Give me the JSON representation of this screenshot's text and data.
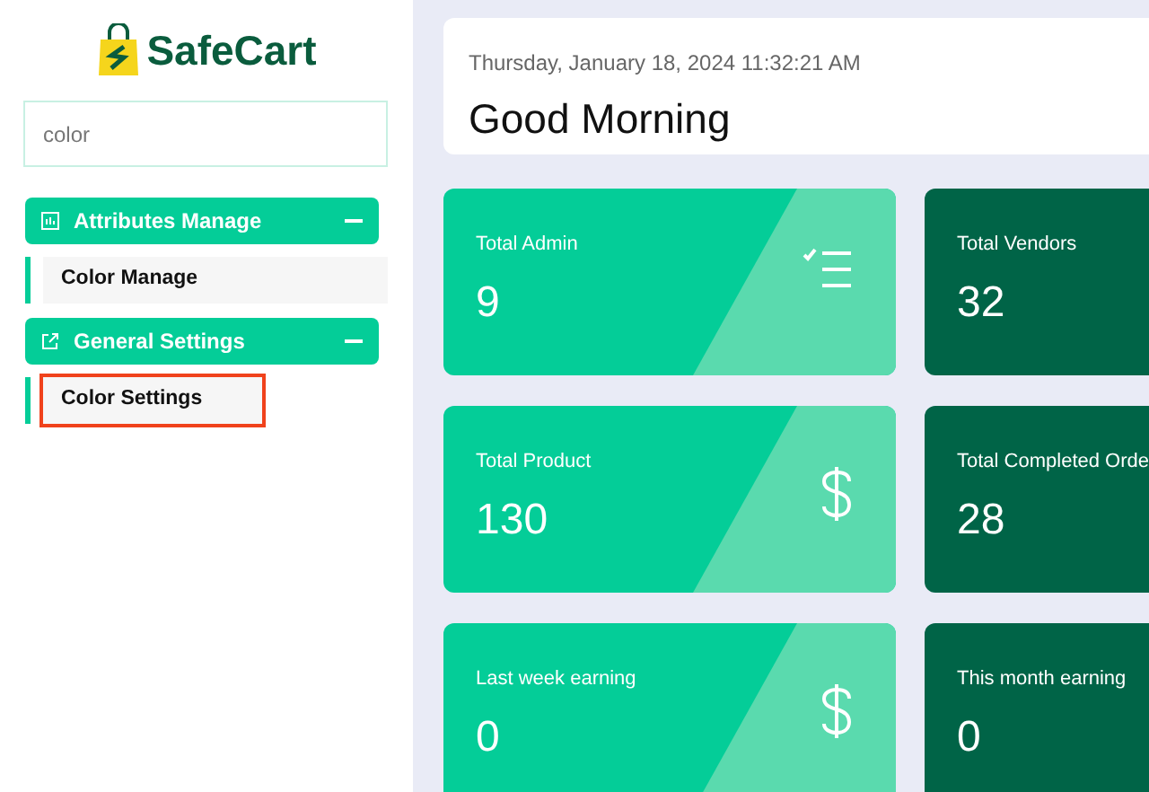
{
  "logo": {
    "text": "SafeCart"
  },
  "search": {
    "value": "color"
  },
  "menu": [
    {
      "label": "Attributes Manage",
      "expanded": true,
      "children": [
        {
          "label": "Color Manage",
          "highlighted": false
        }
      ]
    },
    {
      "label": "General Settings",
      "expanded": true,
      "children": [
        {
          "label": "Color Settings",
          "highlighted": true
        }
      ]
    }
  ],
  "header": {
    "datetime": "Thursday, January 18, 2024 11:32:21 AM",
    "greeting": "Good Morning"
  },
  "cards": [
    {
      "label": "Total Admin",
      "value": "9",
      "color": "#04cd98"
    },
    {
      "label": "Total Vendors",
      "value": "32",
      "color": "#006447"
    },
    {
      "label": "Total Product",
      "value": "130",
      "color": "#04cd98"
    },
    {
      "label": "Total Completed Orde",
      "value": "28",
      "color": "#006447"
    },
    {
      "label": "Last week earning",
      "value": "0",
      "color": "#04cd98"
    },
    {
      "label": "This month earning",
      "value": "0",
      "color": "#006447"
    }
  ]
}
